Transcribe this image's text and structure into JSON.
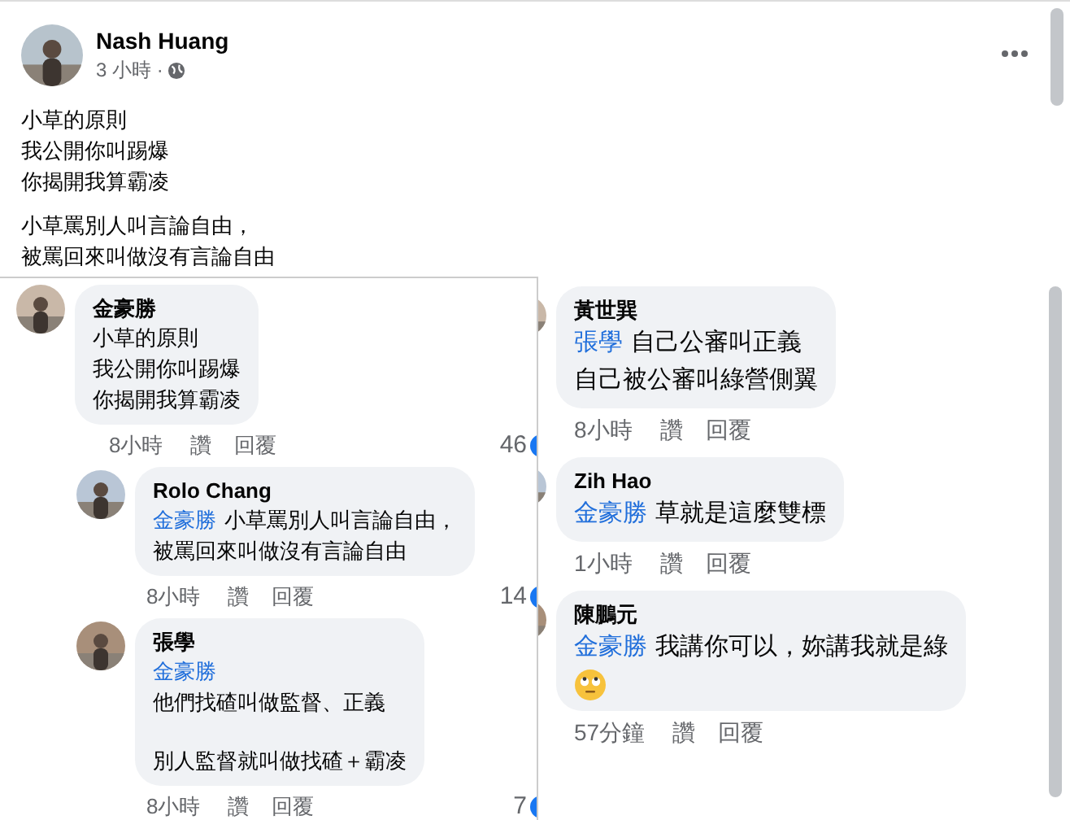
{
  "post": {
    "author": "Nash Huang",
    "time": "3 小時 ·",
    "paragraphs": [
      [
        "小草的原則",
        "我公開你叫踢爆",
        "你揭開我算霸凌"
      ],
      [
        "小草罵別人叫言論自由，",
        "被罵回來叫做沒有言論自由"
      ]
    ]
  },
  "left_comments": [
    {
      "author": "金豪勝",
      "paragraphs": [
        [
          "小草的原則",
          "我公開你叫踢爆",
          "你揭開我算霸凌"
        ]
      ],
      "time": "8小時",
      "like": "讚",
      "reply": "回覆",
      "reactions": "46",
      "children": [
        {
          "author": "Rolo Chang",
          "mention": "金豪勝",
          "paragraphs": [
            [
              "小草罵別人叫言論自由，",
              "被罵回來叫做沒有言論自由"
            ]
          ],
          "time": "8小時",
          "like": "讚",
          "reply": "回覆",
          "reactions": "14"
        },
        {
          "author": "張學",
          "mention": "金豪勝",
          "mention_block": true,
          "paragraphs": [
            [
              "他們找碴叫做監督、正義"
            ],
            [
              "別人監督就叫做找碴＋霸凌"
            ]
          ],
          "time": "8小時",
          "like": "讚",
          "reply": "回覆",
          "reactions": "7"
        }
      ]
    }
  ],
  "right_comments": [
    {
      "author": "黃世巽",
      "mention": "張學",
      "paragraphs": [
        [
          "自己公審叫正義",
          "自己被公審叫綠營側翼"
        ]
      ],
      "time": "8小時",
      "like": "讚",
      "reply": "回覆"
    },
    {
      "author": "Zih Hao",
      "mention": "金豪勝",
      "paragraphs": [
        [
          "草就是這麼雙標"
        ]
      ],
      "time": "1小時",
      "like": "讚",
      "reply": "回覆"
    },
    {
      "author": "陳鵬元",
      "mention": "金豪勝",
      "paragraphs": [
        [
          "我講你可以，妳講我就是綠"
        ]
      ],
      "emoji": true,
      "time": "57分鐘",
      "like": "讚",
      "reply": "回覆"
    }
  ]
}
